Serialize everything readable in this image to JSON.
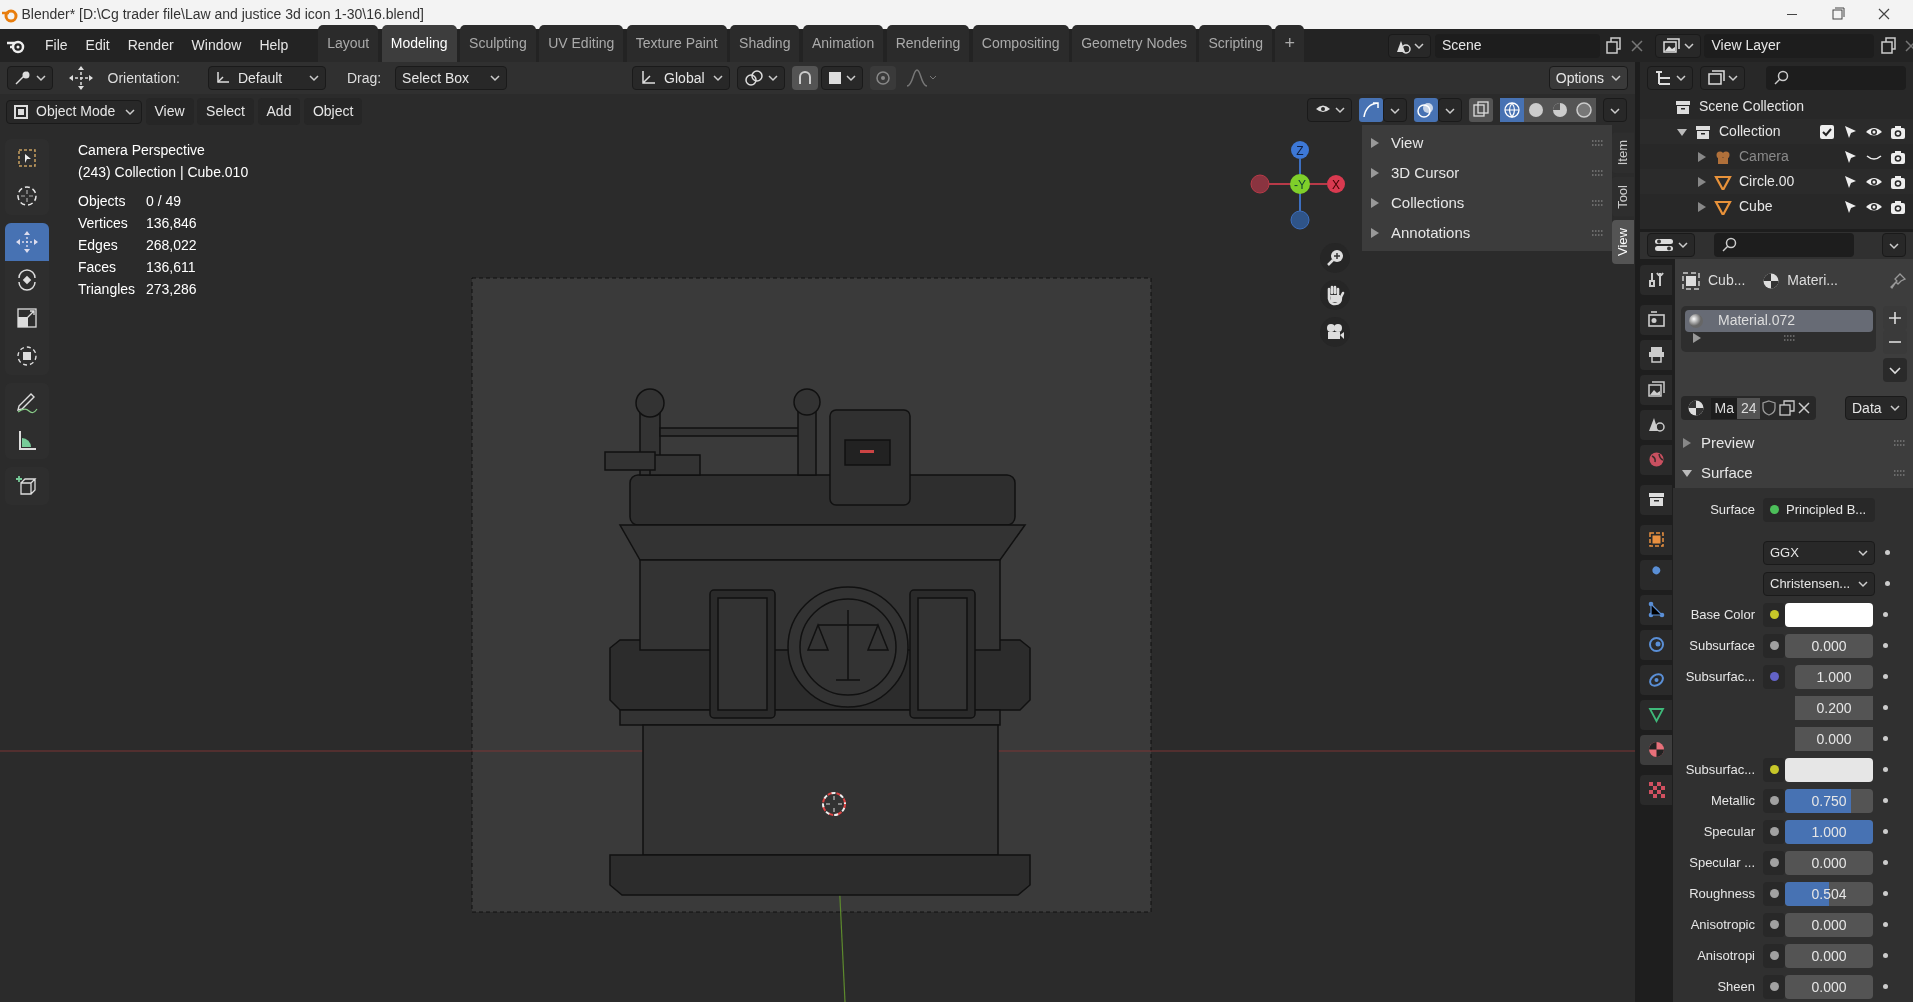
{
  "window": {
    "title": "Blender* [D:\\Cg trader file\\Law and justice 3d icon 1-30\\16.blend]"
  },
  "menu": [
    "File",
    "Edit",
    "Render",
    "Window",
    "Help"
  ],
  "workspace_tabs": [
    {
      "label": "Layout",
      "selected": false
    },
    {
      "label": "Modeling",
      "selected": true
    },
    {
      "label": "Sculpting",
      "selected": false
    },
    {
      "label": "UV Editing",
      "selected": false
    },
    {
      "label": "Texture Paint",
      "selected": false
    },
    {
      "label": "Shading",
      "selected": false
    },
    {
      "label": "Animation",
      "selected": false
    },
    {
      "label": "Rendering",
      "selected": false
    },
    {
      "label": "Compositing",
      "selected": false
    },
    {
      "label": "Geometry Nodes",
      "selected": false
    },
    {
      "label": "Scripting",
      "selected": false
    }
  ],
  "add_tab": "+",
  "scene": "Scene",
  "view_layer": "View Layer",
  "tool_settings": {
    "orientation_label": "Orientation:",
    "orientation": "Default",
    "drag_label": "Drag:",
    "drag": "Select Box",
    "transform_orientation": "Global",
    "options": "Options"
  },
  "viewport_header": {
    "mode": "Object Mode",
    "menus": [
      "View",
      "Select",
      "Add",
      "Object"
    ]
  },
  "tool_groups": [
    [
      {
        "kind": "select_box",
        "selected": false
      },
      {
        "kind": "cursor",
        "selected": false
      }
    ],
    [
      {
        "kind": "move",
        "selected": true
      },
      {
        "kind": "rotate",
        "selected": false
      },
      {
        "kind": "scale",
        "selected": false
      },
      {
        "kind": "transform",
        "selected": false
      }
    ],
    [
      {
        "kind": "annotate",
        "selected": false
      },
      {
        "kind": "measure",
        "selected": false
      }
    ],
    [
      {
        "kind": "add_cube",
        "selected": false
      }
    ]
  ],
  "overlay_info": {
    "view": "Camera Perspective",
    "context": "(243) Collection | Cube.010",
    "stats": [
      {
        "label": "Objects",
        "value": "0 / 49"
      },
      {
        "label": "Vertices",
        "value": "136,846"
      },
      {
        "label": "Edges",
        "value": "268,022"
      },
      {
        "label": "Faces",
        "value": "136,611"
      },
      {
        "label": "Triangles",
        "value": "273,286"
      }
    ]
  },
  "gizmo": {
    "z": "Z",
    "y": "-Y",
    "x": "X"
  },
  "sidebar": {
    "panels": [
      "View",
      "3D Cursor",
      "Collections",
      "Annotations"
    ],
    "tabs": [
      {
        "label": "Item",
        "selected": false
      },
      {
        "label": "Tool",
        "selected": false
      },
      {
        "label": "View",
        "selected": true
      }
    ]
  },
  "outliner": {
    "root": "Scene Collection",
    "items": [
      {
        "name": "Collection",
        "kind": "collection",
        "expanded": true,
        "checked": true,
        "visible": true,
        "children": [
          {
            "name": "Camera",
            "kind": "camera",
            "expanded": false,
            "visible": false
          },
          {
            "name": "Circle.00",
            "kind": "mesh",
            "expanded": false,
            "visible": true
          },
          {
            "name": "Cube",
            "kind": "mesh",
            "expanded": false,
            "visible": true
          }
        ]
      }
    ]
  },
  "properties": {
    "tabs": [
      {
        "kind": "tool",
        "selected": false
      },
      {
        "kind": "render",
        "selected": false
      },
      {
        "kind": "output",
        "selected": false
      },
      {
        "kind": "view_layer",
        "selected": false
      },
      {
        "kind": "scene",
        "selected": false
      },
      {
        "kind": "world",
        "selected": false
      },
      {
        "kind": "collection",
        "selected": false
      },
      {
        "kind": "object",
        "selected": false
      },
      {
        "kind": "modifiers",
        "selected": false
      },
      {
        "kind": "particles",
        "selected": false
      },
      {
        "kind": "physics",
        "selected": false
      },
      {
        "kind": "constraints",
        "selected": false
      },
      {
        "kind": "data",
        "selected": false
      },
      {
        "kind": "material",
        "selected": true
      },
      {
        "kind": "texture",
        "selected": false
      }
    ],
    "breadcrumb": [
      "Cub...",
      "Materi..."
    ],
    "material_slots": [
      {
        "name": "Material.072",
        "selected": true
      }
    ],
    "datablock": {
      "name": "Ma",
      "users": "24",
      "link": "Data"
    },
    "panels": [
      {
        "label": "Preview",
        "expanded": false
      },
      {
        "label": "Surface",
        "expanded": true
      }
    ],
    "surface": {
      "label": "Surface",
      "shader": "Principled B..."
    },
    "fields": [
      {
        "kind": "dropdown",
        "value": "GGX"
      },
      {
        "kind": "dropdown",
        "value": "Christensen..."
      },
      {
        "kind": "color",
        "label": "Base Color",
        "color": "#ffffff"
      },
      {
        "kind": "slider",
        "label": "Subsurface",
        "value": "0.000",
        "level": 0
      },
      {
        "kind": "vector",
        "label": "Subsurfac...",
        "values": [
          "1.000",
          "0.200",
          "0.000"
        ]
      },
      {
        "kind": "color",
        "label": "Subsurfac...",
        "color": "#e6e6e6"
      },
      {
        "kind": "slider",
        "label": "Metallic",
        "value": "0.750",
        "level": 0.75
      },
      {
        "kind": "slider",
        "label": "Specular",
        "value": "1.000",
        "level": 1
      },
      {
        "kind": "slider",
        "label": "Specular ...",
        "value": "0.000",
        "level": 0
      },
      {
        "kind": "slider",
        "label": "Roughness",
        "value": "0.504",
        "level": 0.504
      },
      {
        "kind": "slider",
        "label": "Anisotropic",
        "value": "0.000",
        "level": 0
      },
      {
        "kind": "slider",
        "label": "Anisotropi",
        "value": "0.000",
        "level": 0
      },
      {
        "kind": "slider",
        "label": "Sheen",
        "value": "0.000",
        "level": 0
      }
    ]
  }
}
